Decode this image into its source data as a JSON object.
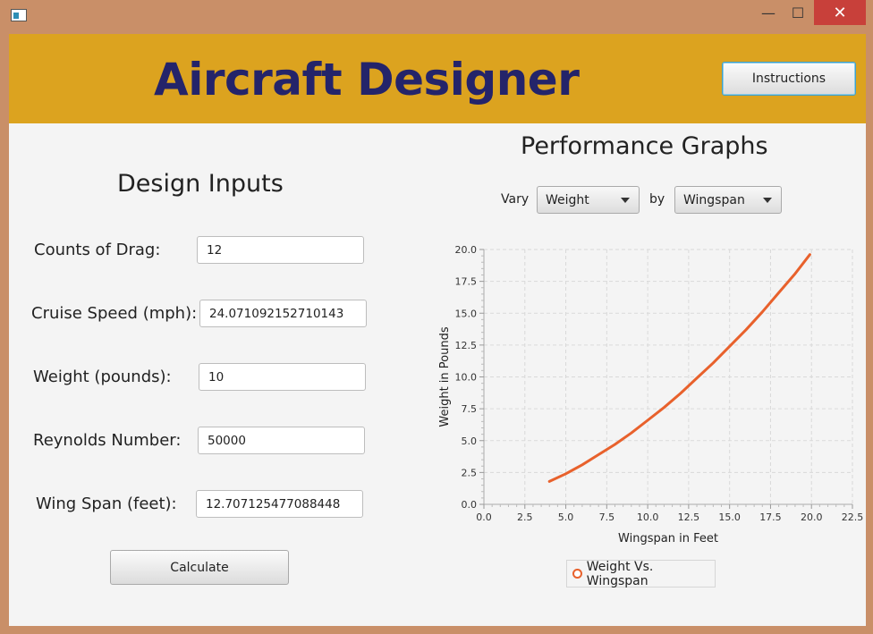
{
  "window": {
    "min_glyph": "—",
    "max_glyph": "☐",
    "close_glyph": "✕"
  },
  "header": {
    "title": "Aircraft Designer",
    "instructions_label": "Instructions",
    "bg_color": "#dca31f",
    "title_color": "#24246a"
  },
  "inputs": {
    "title": "Design Inputs",
    "fields": [
      {
        "label": "Counts of Drag:",
        "value": "12"
      },
      {
        "label": "Cruise Speed (mph):",
        "value": "24.071092152710143"
      },
      {
        "label": "Weight (pounds):",
        "value": "10"
      },
      {
        "label": "Reynolds Number:",
        "value": "50000"
      },
      {
        "label": "Wing Span (feet):",
        "value": "12.707125477088448"
      }
    ],
    "calculate_label": "Calculate"
  },
  "graph": {
    "title": "Performance Graphs",
    "vary_label": "Vary",
    "vary_value": "Weight",
    "by_label": "by",
    "by_value": "Wingspan",
    "legend_label": "Weight Vs. Wingspan"
  },
  "chart_data": {
    "type": "line",
    "xlabel": "Wingspan in Feet",
    "ylabel": "Weight in Pounds",
    "xlim": [
      0,
      22.5
    ],
    "ylim": [
      0,
      20
    ],
    "xticks": [
      "0.0",
      "2.5",
      "5.0",
      "7.5",
      "10.0",
      "12.5",
      "15.0",
      "17.5",
      "20.0",
      "22.5"
    ],
    "yticks": [
      "0.0",
      "2.5",
      "5.0",
      "7.5",
      "10.0",
      "12.5",
      "15.0",
      "17.5",
      "20.0"
    ],
    "grid": true,
    "legend_position": "bottom",
    "series": [
      {
        "name": "Weight Vs. Wingspan",
        "color": "#e8612c",
        "x": [
          4.0,
          5.0,
          6.0,
          7.0,
          8.0,
          9.0,
          10.0,
          11.0,
          12.0,
          13.0,
          14.0,
          15.0,
          16.0,
          17.0,
          18.0,
          19.0,
          19.9
        ],
        "y": [
          1.8,
          2.4,
          3.1,
          3.9,
          4.7,
          5.6,
          6.6,
          7.6,
          8.7,
          9.9,
          11.1,
          12.4,
          13.7,
          15.1,
          16.6,
          18.1,
          19.6
        ]
      }
    ]
  }
}
